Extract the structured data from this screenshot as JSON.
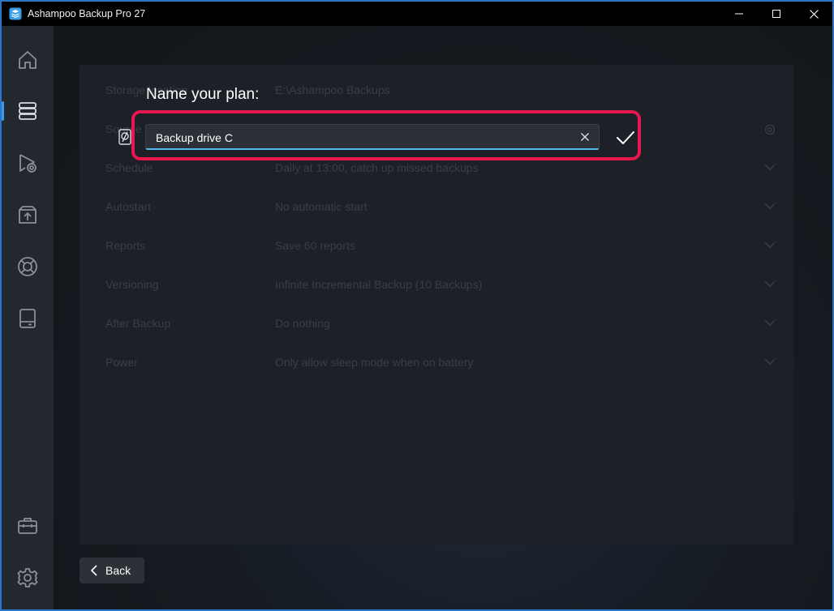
{
  "window": {
    "title": "Ashampoo Backup Pro 27"
  },
  "sidebar": {
    "items": [
      {
        "icon": "home-icon"
      },
      {
        "icon": "backup-plans-icon",
        "active": true
      },
      {
        "icon": "restore-icon"
      },
      {
        "icon": "rescue-system-icon"
      },
      {
        "icon": "help-lifebuoy-icon"
      },
      {
        "icon": "drive-icon"
      },
      {
        "icon": "toolbox-icon"
      },
      {
        "icon": "settings-gear-icon"
      }
    ]
  },
  "settings_rows": [
    {
      "label": "Storage location",
      "value": "E:\\Ashampoo Backups"
    },
    {
      "label": "Source",
      "value": ""
    },
    {
      "label": "Schedule",
      "value": "Daily at 13:00, catch up missed backups"
    },
    {
      "label": "Autostart",
      "value": "No automatic start"
    },
    {
      "label": "Reports",
      "value": "Save 60 reports"
    },
    {
      "label": "Versioning",
      "value": "Infinite Incremental Backup (10 Backups)"
    },
    {
      "label": "After Backup",
      "value": "Do nothing"
    },
    {
      "label": "Power",
      "value": "Only allow sleep mode when on battery"
    }
  ],
  "name_dialog": {
    "title": "Name your plan:",
    "input_value": "Backup drive C"
  },
  "footer": {
    "back_label": "Back"
  },
  "colors": {
    "accent": "#52b8f0",
    "highlight": "#e8174f",
    "window_border": "#2b76c8"
  }
}
